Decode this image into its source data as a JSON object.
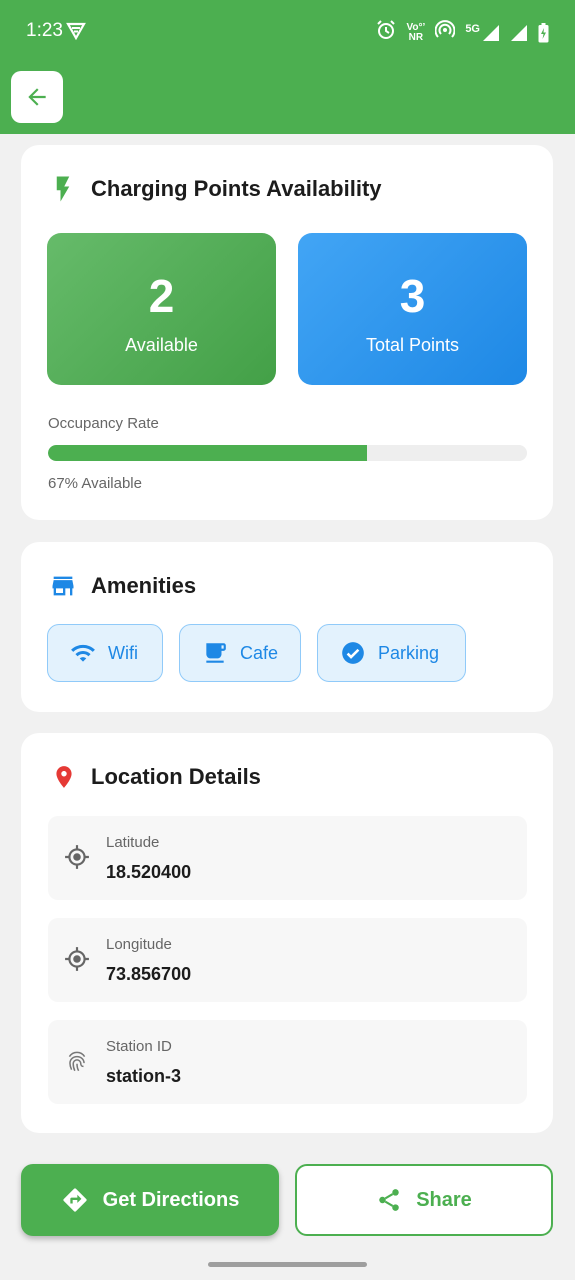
{
  "status_bar": {
    "time": "1:23",
    "volte": "Vo°’",
    "nr": "NR",
    "network": "5G"
  },
  "charging": {
    "title": "Charging Points Availability",
    "available_value": "2",
    "available_label": "Available",
    "total_value": "3",
    "total_label": "Total Points",
    "occupancy_label": "Occupancy Rate",
    "occupancy_fraction": 0.667,
    "occupancy_text": "67% Available"
  },
  "amenities": {
    "title": "Amenities",
    "items": [
      {
        "label": "Wifi",
        "icon": "wifi-icon"
      },
      {
        "label": "Cafe",
        "icon": "cafe-icon"
      },
      {
        "label": "Parking",
        "icon": "check-circle-icon"
      }
    ]
  },
  "location": {
    "title": "Location Details",
    "details": [
      {
        "label": "Latitude",
        "value": "18.520400",
        "icon": "gps-icon"
      },
      {
        "label": "Longitude",
        "value": "73.856700",
        "icon": "gps-icon"
      },
      {
        "label": "Station ID",
        "value": "station-3",
        "icon": "fingerprint-icon"
      }
    ]
  },
  "actions": {
    "directions_label": "Get Directions",
    "share_label": "Share"
  },
  "colors": {
    "primary": "#4caf50",
    "blue": "#1e88e5",
    "red": "#e53935"
  }
}
